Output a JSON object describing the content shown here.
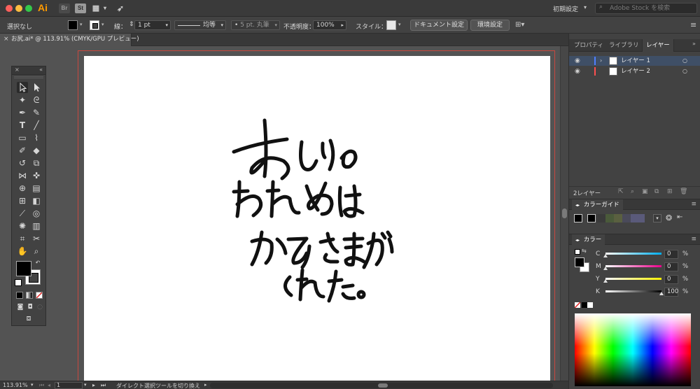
{
  "app": {
    "logo": "Ai",
    "bridge_label": "Br",
    "stock_label": "St",
    "workspace_label": "初期設定",
    "stock_search_placeholder": "Adobe Stock を検索"
  },
  "controlbar": {
    "selection_label": "選択なし",
    "stroke_label": "線：",
    "stroke_weight": "1 pt",
    "stroke_profile": "均等",
    "brush_label": "5 pt. 丸筆",
    "opacity_label": "不透明度：",
    "opacity_value": "100%",
    "style_label": "スタイル：",
    "document_setup_button": "ドキュメント設定",
    "preferences_button": "環境設定"
  },
  "document": {
    "tab_title": "お尻.ai* @ 113.91% (CMYK/GPU プレビュー)",
    "artwork_text_lines": [
      "おしりの",
      "われめは",
      "かみさまが",
      "くれた。"
    ]
  },
  "layers_panel": {
    "tabs": [
      "プロパティ",
      "ライブラリ",
      "レイヤー"
    ],
    "active_tab": "レイヤー",
    "layers": [
      {
        "name": "レイヤー 1",
        "color": "#4f7fff",
        "selected": true
      },
      {
        "name": "レイヤー 2",
        "color": "#ff4f4f",
        "selected": false
      }
    ],
    "layer_count": "2レイヤー"
  },
  "color_guide_panel": {
    "title": "カラーガイド",
    "swatches": [
      "#3a3a3a",
      "#4a5a3a",
      "#5a6040",
      "#4a4a5a",
      "#5a5a7a"
    ]
  },
  "color_panel": {
    "title": "カラー",
    "channels": [
      {
        "label": "C",
        "value": "0",
        "level": 0
      },
      {
        "label": "M",
        "value": "0",
        "level": 0
      },
      {
        "label": "Y",
        "value": "0",
        "level": 0
      },
      {
        "label": "K",
        "value": "100",
        "level": 1
      }
    ],
    "unit": "%"
  },
  "statusbar": {
    "zoom": "113.91%",
    "artboard_number": "1",
    "hint": "ダイレクト選択ツールを切り換え"
  },
  "colors": {
    "accent_layer_selected": "#3f4f66",
    "bleed_line": "#c9483f"
  }
}
